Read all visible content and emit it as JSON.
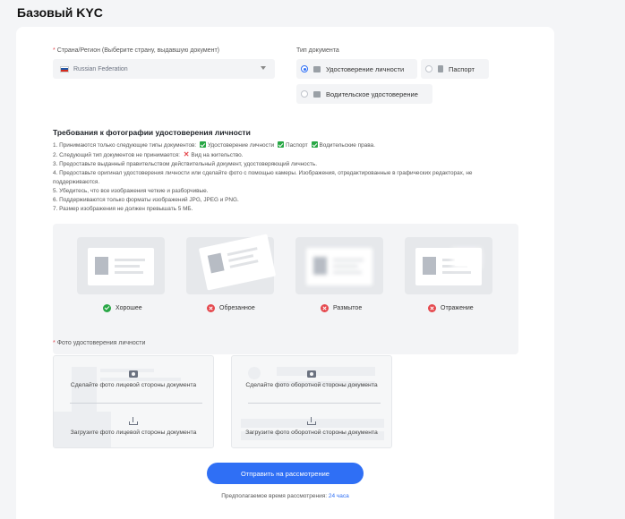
{
  "page": {
    "title": "Базовый KYC"
  },
  "country": {
    "label": "Страна/Регион (Выберите страну, выдавшую документ)",
    "value": "Russian Federation",
    "flag_colors": [
      "#ffffff",
      "#1c57a7",
      "#d52b1e"
    ]
  },
  "doc_type": {
    "label": "Тип документа",
    "options": [
      {
        "label": "Удостоверение личности",
        "icon": "id-card-icon",
        "selected": true
      },
      {
        "label": "Паспорт",
        "icon": "passport-icon",
        "selected": false
      },
      {
        "label": "Водительское удостоверение",
        "icon": "driver-license-icon",
        "selected": false
      }
    ]
  },
  "requirements": {
    "title": "Требования к фотографии удостоверения личности",
    "line1_prefix": "1. Принимаются только следующие типы документов:",
    "line1_items": [
      "Удостоверение личности",
      "Паспорт",
      "Водительские права."
    ],
    "line2_prefix": "2. Следующий тип документов не принимается:",
    "line2_item": "Вид на жительство.",
    "line3": "3. Предоставьте выданный правительством действительный документ, удостоверяющий личность.",
    "line4": "4. Предоставьте оригинал удостоверения личности или сделайте фото с помощью камеры. Изображения, отредактированные в графических редакторах, не поддерживаются.",
    "line5": "5. Убедитесь, что все изображения четкие и разборчивые.",
    "line6": "6. Поддерживаются только форматы изображений JPG, JPEG и PNG.",
    "line7": "7. Размер изображения не должен превышать 5 МБ."
  },
  "samples": [
    {
      "caption": "Хорошее",
      "status": "good"
    },
    {
      "caption": "Обрезанное",
      "status": "bad"
    },
    {
      "caption": "Размытое",
      "status": "bad"
    },
    {
      "caption": "Отражение",
      "status": "bad"
    }
  ],
  "upload": {
    "label": "Фото удостоверения личности",
    "front": {
      "photo_text": "Сделайте фото лицевой стороны документа",
      "upload_text": "Загрузите фото лицевой стороны документа"
    },
    "back": {
      "photo_text": "Сделайте фото оборотной стороны документа",
      "upload_text": "Загрузите фото оборотной стороны документа"
    }
  },
  "submit": {
    "label": "Отправить на рассмотрение",
    "eta_prefix": "Предполагаемое время рассмотрения:",
    "eta_value": "24 часа"
  },
  "colors": {
    "accent": "#2f6ff5",
    "good": "#28a745",
    "bad": "#e5484d"
  }
}
